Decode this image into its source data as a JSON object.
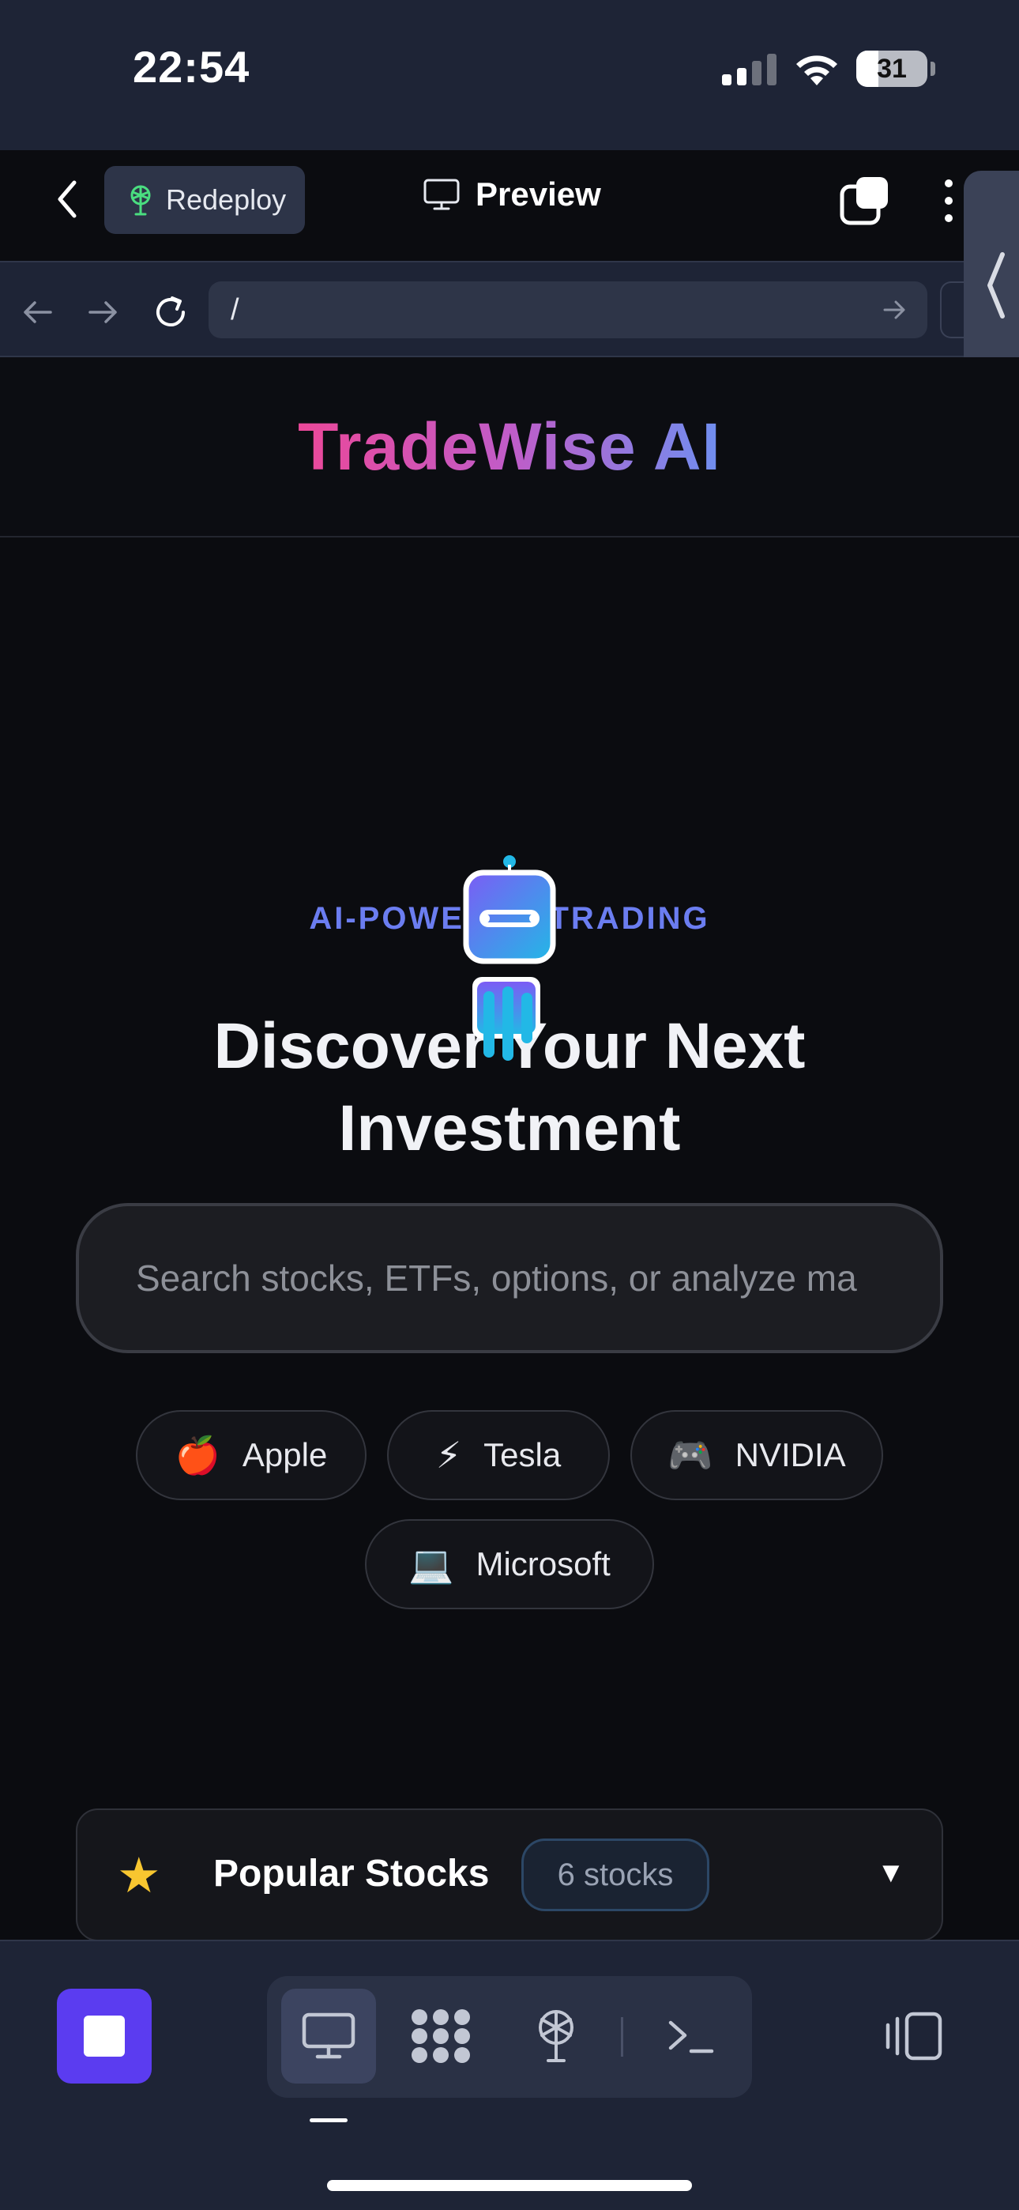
{
  "status_bar": {
    "time": "22:54",
    "battery": "31",
    "battery_level_pct": 31
  },
  "app_bar": {
    "redeploy_label": "Redeploy",
    "preview_label": "Preview"
  },
  "browser": {
    "url": "/"
  },
  "site": {
    "brand": "TradeWise AI",
    "tagline": "AI-POWERED TRADING",
    "headline_line1": "Discover Your Next",
    "headline_line2": "Investment",
    "search_placeholder": "Search stocks, ETFs, options, or analyze ma",
    "quick_picks": [
      {
        "emoji": "🍎",
        "label": "Apple"
      },
      {
        "emoji": "⚡",
        "label": "Tesla"
      },
      {
        "emoji": "🎮",
        "label": "NVIDIA"
      },
      {
        "emoji": "💻",
        "label": "Microsoft"
      }
    ],
    "popular": {
      "icon": "★",
      "title": "Popular Stocks",
      "count": "6 stocks",
      "toggle": "▼"
    }
  },
  "colors": {
    "accent_purple": "#5b3cf0",
    "brand_pink": "#ec4899",
    "brand_blue": "#6f8ff0",
    "tagline": "#6b7df0",
    "star": "#f8c630"
  },
  "icons": {
    "back": "chevron-left-icon",
    "redeploy": "antenna-icon",
    "preview": "monitor-icon",
    "tabs": "tabs-icon",
    "more": "more-vertical-icon",
    "side_handle": "chevron-left-icon",
    "nav_back": "arrow-left-icon",
    "nav_forward": "arrow-right-icon",
    "reload": "reload-icon",
    "url_go": "arrow-right-icon",
    "stop": "stop-icon",
    "preview_tool": "monitor-icon",
    "pages_tool": "grid-icon",
    "deploy_tool": "antenna-icon",
    "terminal_tool": "terminal-icon",
    "device": "device-rotate-icon"
  }
}
